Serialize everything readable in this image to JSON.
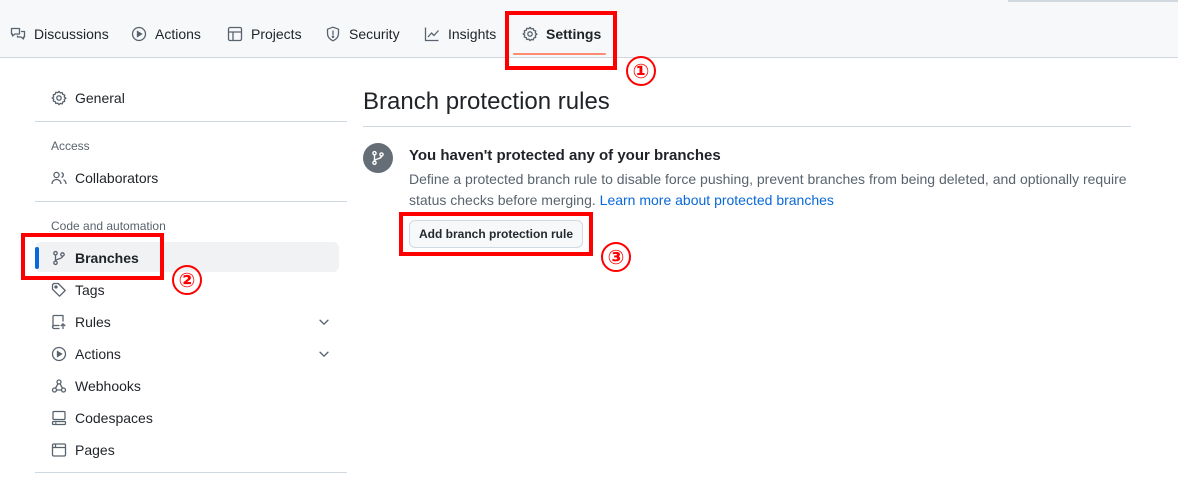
{
  "nav": {
    "tabs": [
      {
        "label": "Discussions",
        "icon": "comment-discussion-icon"
      },
      {
        "label": "Actions",
        "icon": "play-icon"
      },
      {
        "label": "Projects",
        "icon": "table-icon"
      },
      {
        "label": "Security",
        "icon": "shield-icon"
      },
      {
        "label": "Insights",
        "icon": "graph-icon"
      },
      {
        "label": "Settings",
        "icon": "gear-icon",
        "active": true
      }
    ]
  },
  "sidebar": {
    "general": "General",
    "access_heading": "Access",
    "collaborators": "Collaborators",
    "code_heading": "Code and automation",
    "items": [
      {
        "label": "Branches",
        "icon": "git-branch-icon",
        "active": true
      },
      {
        "label": "Tags",
        "icon": "tag-icon"
      },
      {
        "label": "Rules",
        "icon": "repo-push-icon",
        "expandable": true
      },
      {
        "label": "Actions",
        "icon": "play-icon",
        "expandable": true
      },
      {
        "label": "Webhooks",
        "icon": "webhook-icon"
      },
      {
        "label": "Codespaces",
        "icon": "codespaces-icon"
      },
      {
        "label": "Pages",
        "icon": "browser-icon"
      }
    ]
  },
  "main": {
    "title": "Branch protection rules",
    "empty_title": "You haven't protected any of your branches",
    "empty_desc": "Define a protected branch rule to disable force pushing, prevent branches from being deleted, and optionally require status checks before merging.",
    "learn_more": "Learn more about protected branches",
    "add_button": "Add branch protection rule"
  },
  "annotations": {
    "step1": "①",
    "step2": "②",
    "step3": "③",
    "color": "#ff0000"
  },
  "colors": {
    "accent": "#0969da",
    "tab_underline": "#fd8c73"
  }
}
